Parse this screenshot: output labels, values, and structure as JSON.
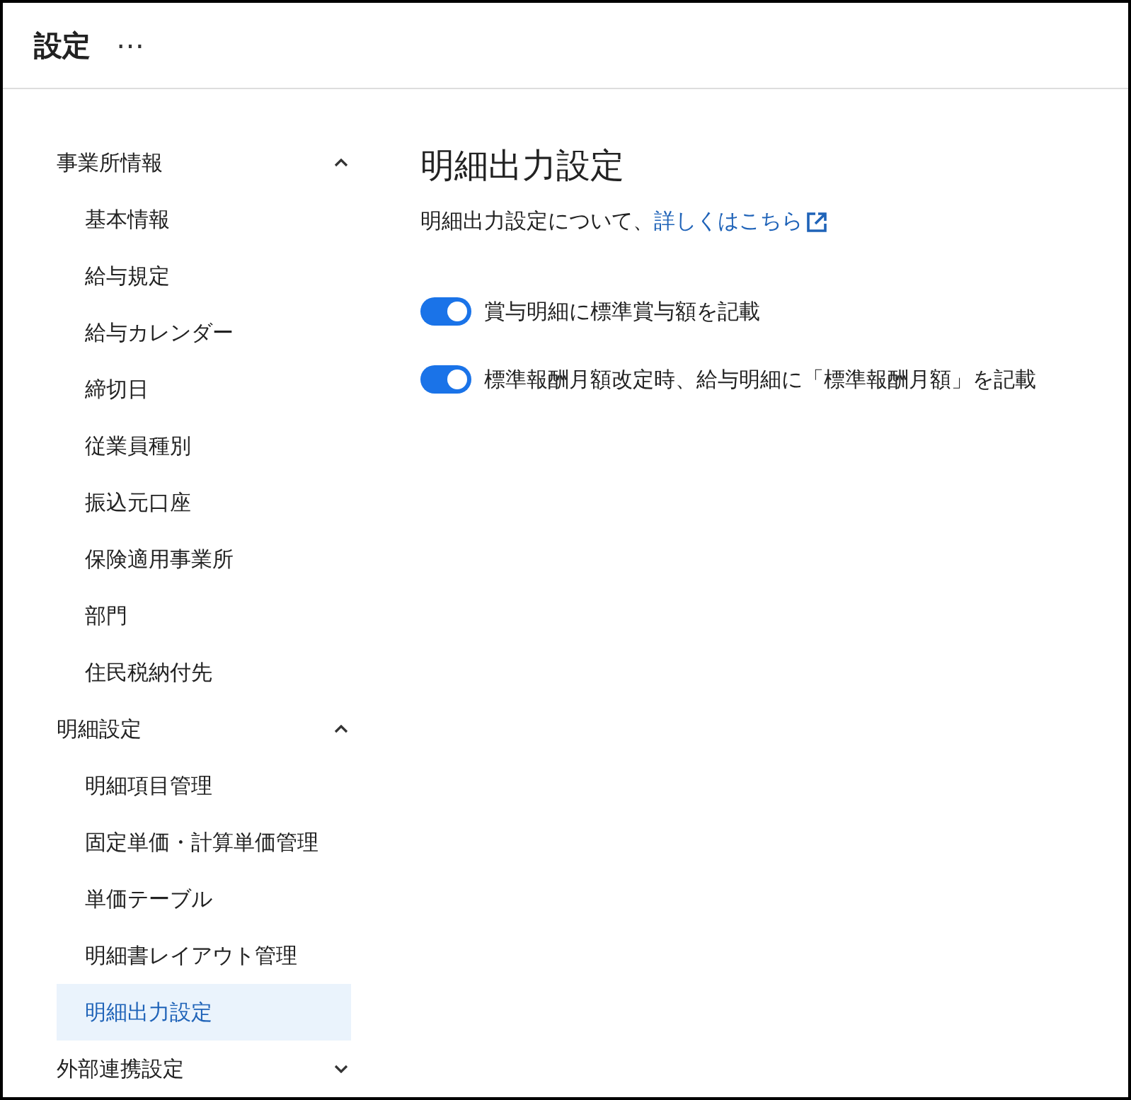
{
  "header": {
    "title": "設定",
    "more": "⋯"
  },
  "sidebar": {
    "groups": [
      {
        "label": "事業所情報",
        "expanded": true,
        "items": [
          {
            "label": "基本情報",
            "selected": false
          },
          {
            "label": "給与規定",
            "selected": false
          },
          {
            "label": "給与カレンダー",
            "selected": false
          },
          {
            "label": "締切日",
            "selected": false
          },
          {
            "label": "従業員種別",
            "selected": false
          },
          {
            "label": "振込元口座",
            "selected": false
          },
          {
            "label": "保険適用事業所",
            "selected": false
          },
          {
            "label": "部門",
            "selected": false
          },
          {
            "label": "住民税納付先",
            "selected": false
          }
        ]
      },
      {
        "label": "明細設定",
        "expanded": true,
        "items": [
          {
            "label": "明細項目管理",
            "selected": false
          },
          {
            "label": "固定単価・計算単価管理",
            "selected": false
          },
          {
            "label": "単価テーブル",
            "selected": false
          },
          {
            "label": "明細書レイアウト管理",
            "selected": false
          },
          {
            "label": "明細出力設定",
            "selected": true
          }
        ]
      },
      {
        "label": "外部連携設定",
        "expanded": false
      }
    ]
  },
  "content": {
    "title": "明細出力設定",
    "description": "明細出力設定について、",
    "link": "詳しくはこちら",
    "toggles": [
      {
        "label": "賞与明細に標準賞与額を記載",
        "on": true
      },
      {
        "label": "標準報酬月額改定時、給与明細に「標準報酬月額」を記載",
        "on": true
      }
    ]
  }
}
